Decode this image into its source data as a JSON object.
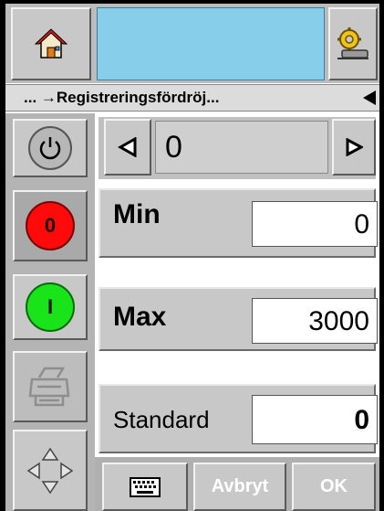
{
  "breadcrumb": {
    "prefix": "... →",
    "path": "Registreringsfördröj..."
  },
  "value_selector": {
    "value": "0"
  },
  "fields": {
    "min_label": "Min",
    "min_value": "0",
    "max_label": "Max",
    "max_value": "3000",
    "standard_label": "Standard",
    "standard_value": "0"
  },
  "toolbar": {
    "cancel_label": "Avbryt",
    "ok_label": "OK"
  },
  "colors": {
    "status_field": "#87ceeb",
    "stop": "#ff0a0a",
    "start": "#19e319"
  },
  "icons": [
    "home-icon",
    "settings-icon",
    "power-icon",
    "printer-icon",
    "navigation-icon",
    "keyboard-icon",
    "arrow-left-icon",
    "arrow-right-icon"
  ]
}
